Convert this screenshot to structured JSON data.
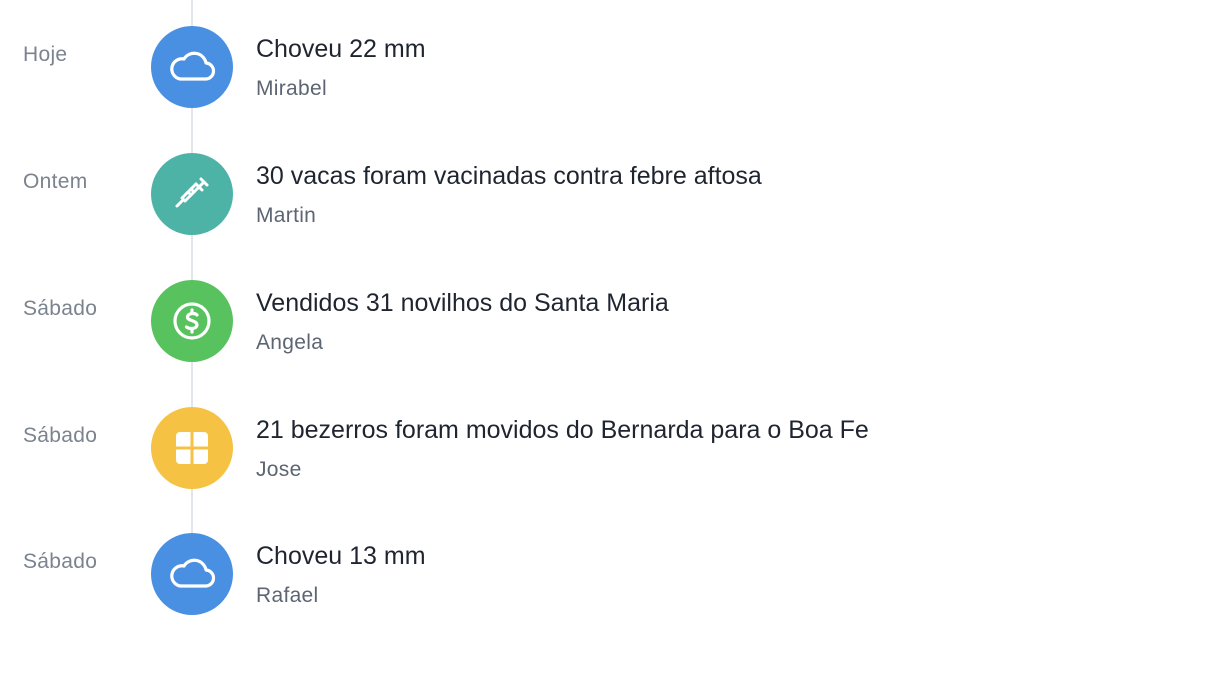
{
  "events": [
    {
      "date": "Hoje",
      "icon": "cloud-icon",
      "color": "#4a90e2",
      "title": "Choveu 22 mm",
      "author": "Mirabel"
    },
    {
      "date": "Ontem",
      "icon": "syringe-icon",
      "color": "#4db3a7",
      "title": "30 vacas foram vacinadas contra febre aftosa",
      "author": "Martin"
    },
    {
      "date": "Sábado",
      "icon": "dollar-icon",
      "color": "#58c25f",
      "title": "Vendidos 31 novilhos do Santa Maria",
      "author": "Angela"
    },
    {
      "date": "Sábado",
      "icon": "grid-icon",
      "color": "#f5c243",
      "title": "21 bezerros foram movidos do Bernarda para o Boa Fe",
      "author": "Jose"
    },
    {
      "date": "Sábado",
      "icon": "cloud-icon",
      "color": "#4a90e2",
      "title": "Choveu 13 mm",
      "author": "Rafael"
    }
  ]
}
